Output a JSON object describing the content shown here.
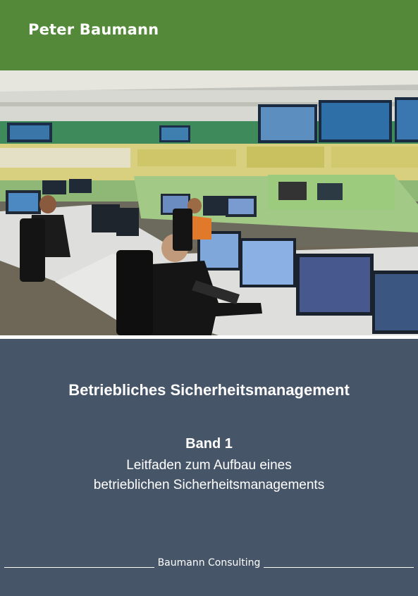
{
  "cover": {
    "author": "Peter Baumann",
    "photo_description": "control-room-photo",
    "title": "Betriebliches Sicherheitsmanagement",
    "volume": "Band 1",
    "subtitle_line1": "Leitfaden zum Aufbau eines",
    "subtitle_line2": "betrieblichen Sicherheitsmanagements",
    "publisher": "Baumann Consulting"
  },
  "colors": {
    "header_green": "#55893a",
    "footer_slate": "#475569",
    "text": "#ffffff"
  }
}
